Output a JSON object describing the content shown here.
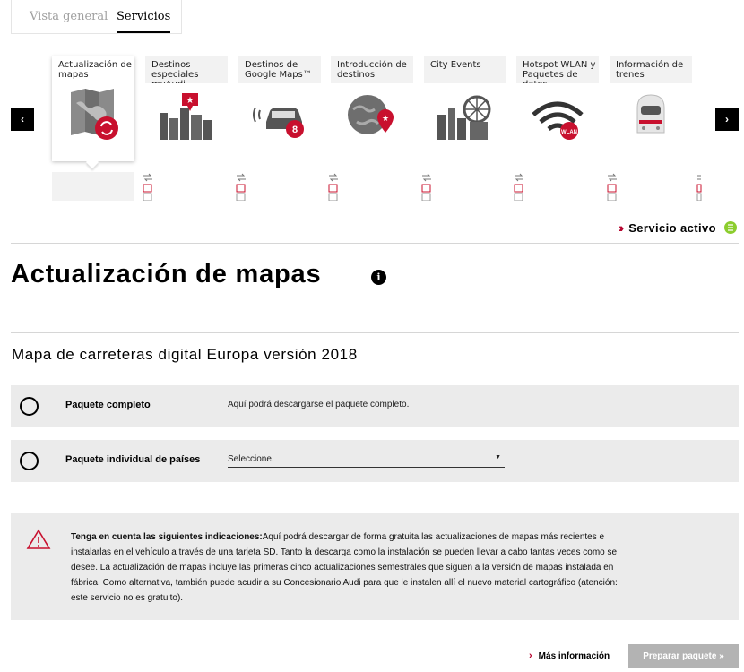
{
  "tabs": [
    {
      "label": "Vista general"
    },
    {
      "label": "Servicios"
    }
  ],
  "carousel": {
    "prev_label": "‹",
    "next_label": "›",
    "cards": [
      {
        "label": "Actualización de mapas",
        "icon": "map-update-icon"
      },
      {
        "label": "Destinos especiales myAudi",
        "icon": "special-destinations-icon"
      },
      {
        "label": "Destinos de Google Maps™",
        "icon": "google-maps-car-icon"
      },
      {
        "label": "Introducción de destinos",
        "icon": "globe-destination-icon"
      },
      {
        "label": "City Events",
        "icon": "city-events-icon"
      },
      {
        "label": "Hotspot WLAN y Paquetes de datos",
        "icon": "wlan-hotspot-icon"
      },
      {
        "label": "Información de trenes",
        "icon": "train-icon"
      }
    ]
  },
  "status": {
    "label": "Servicio activo",
    "color": "#8ccd2e"
  },
  "page": {
    "title": "Actualización de mapas",
    "info_icon": "i"
  },
  "section": {
    "title": "Mapa de carreteras digital Europa versión 2018"
  },
  "options": [
    {
      "label": "Paquete completo",
      "desc": "Aquí podrá descargarse el paquete completo."
    },
    {
      "label": "Paquete individual de países",
      "select_value": "Seleccione."
    }
  ],
  "notice": {
    "lead": "Tenga en cuenta las siguientes indicaciones:",
    "body": "Aquí podrá descargar de forma gratuita las actualizaciones de mapas más recientes e instalarlas en el vehículo a través de una tarjeta SD. Tanto la descarga como la instalación se pueden llevar a cabo tantas veces como se desee. La actualización de mapas incluye las primeras cinco actualizaciones semestrales que siguen a la versión de mapas instalada en fábrica. Como alternativa, también puede acudir a su Concesionario Audi para que le instalen allí el nuevo material cartográfico (atención: este servicio no es gratuito)."
  },
  "footer": {
    "more_label": "Más información",
    "prepare_label": "Preparar paquete »"
  },
  "colors": {
    "accent_red": "#b5002b",
    "panel_gray": "#ebebeb",
    "disabled_button": "#b3b3b3"
  }
}
